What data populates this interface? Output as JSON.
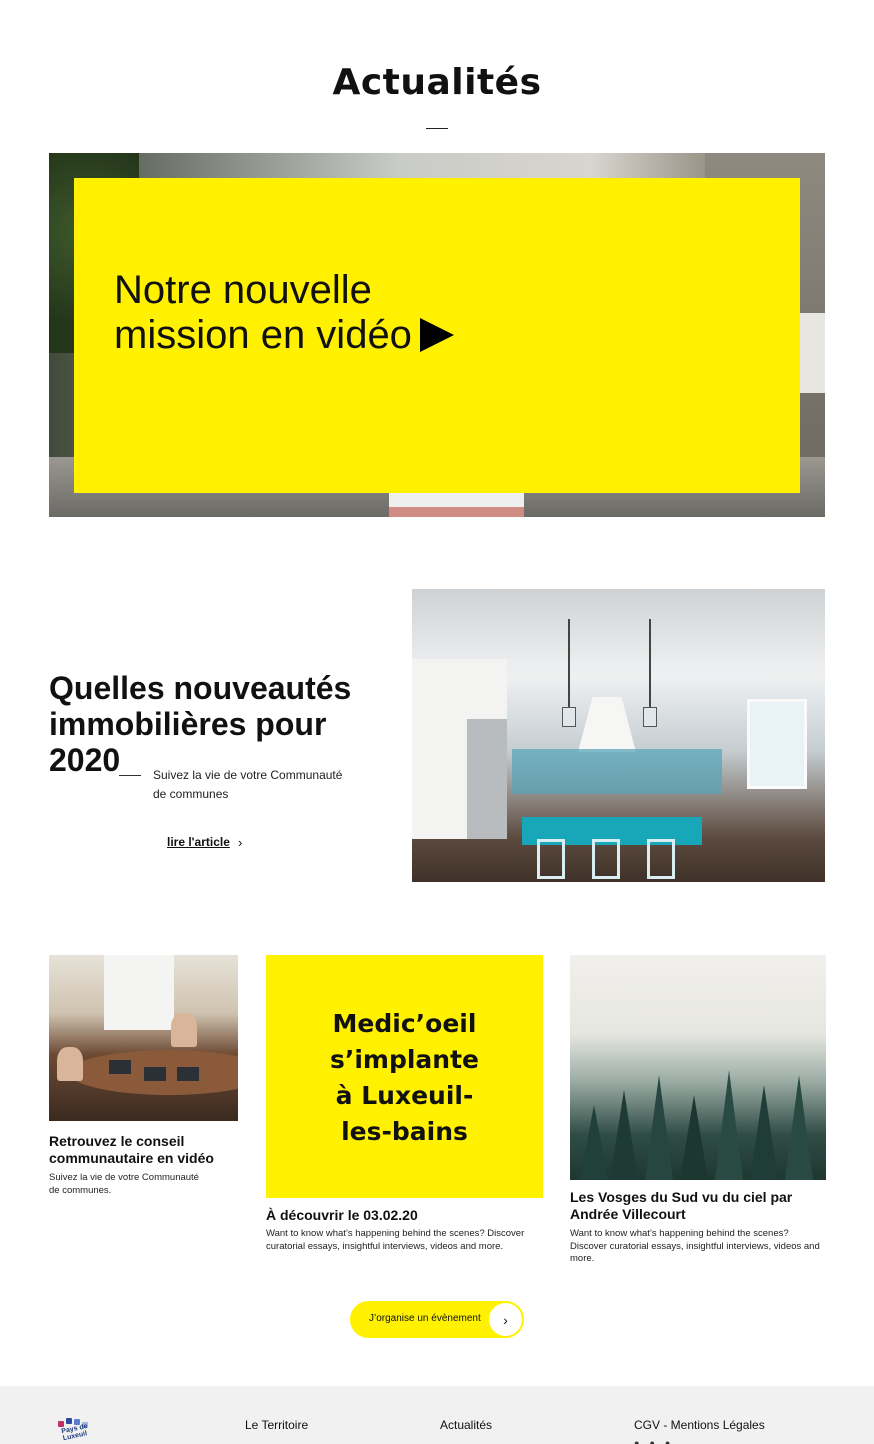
{
  "page": {
    "title": "Actualités"
  },
  "hero": {
    "title": "Notre nouvelle mission en vidéo",
    "play_icon": "play-icon"
  },
  "feature": {
    "title": "Quelles nouveautés immobilières pour 2020",
    "description": "Suivez la vie de votre Communauté de communes",
    "link_label": "lire l'article",
    "link_icon": "chevron-right-icon"
  },
  "cards": [
    {
      "title": "Retrouvez le conseil communautaire en vidéo",
      "description": "Suivez la vie de votre Communauté de communes."
    },
    {
      "banner": "Medic’oeil s’implante à Luxeuil-les-bains",
      "title": "À découvrir le 03.02.20",
      "description": "Want to know what’s happening behind the scenes? Discover curatorial essays, insightful interviews, videos and more."
    },
    {
      "title": "Les Vosges du Sud vu du ciel par Andrée Villecourt",
      "description": "Want to know what’s happening behind the scenes? Discover curatorial essays, insightful interviews, videos and more."
    }
  ],
  "event_button": {
    "label": "J’organise un évènement",
    "icon": "chevron-right-icon"
  },
  "footer": {
    "logo_text": "Pays de Luxeuil",
    "links": [
      "Le Territoire",
      "Actualités",
      "CGV - Mentions Légales"
    ]
  },
  "colors": {
    "accent_yellow": "#fff100",
    "text": "#111111",
    "footer_bg": "#f1f1f1"
  }
}
